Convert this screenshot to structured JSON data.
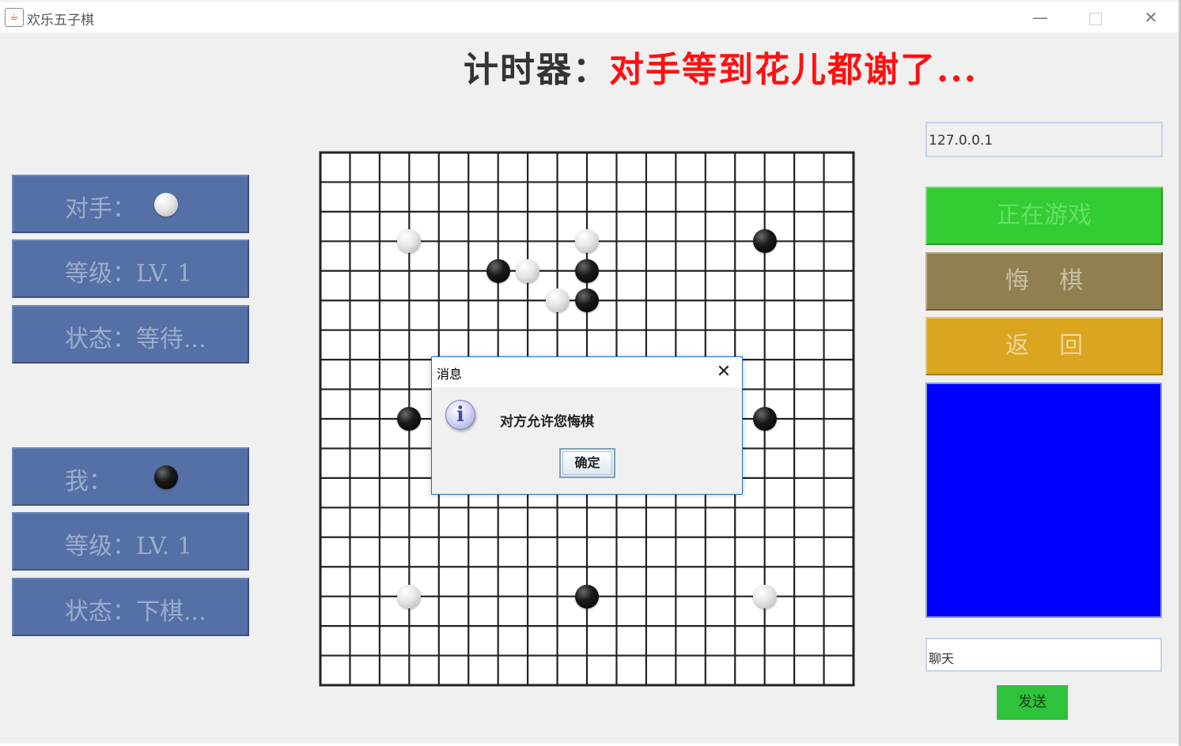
{
  "window": {
    "title": "欢乐五子棋",
    "minimize_glyph": "—",
    "close_glyph": "✕"
  },
  "timer": {
    "label": "计时器：",
    "value": "对手等到花儿都谢了..."
  },
  "opponent": {
    "label": "对手：",
    "stone": "white",
    "level": "等级：LV. 1",
    "status": "状态：等待..."
  },
  "me": {
    "label": "我：",
    "stone": "black",
    "level": "等级：LV. 1",
    "status": "状态：下棋..."
  },
  "board": {
    "size": 19,
    "stones": [
      {
        "color": "white",
        "col": 3,
        "row": 3
      },
      {
        "color": "white",
        "col": 9,
        "row": 3
      },
      {
        "color": "black",
        "col": 15,
        "row": 3
      },
      {
        "color": "black",
        "col": 6,
        "row": 4
      },
      {
        "color": "white",
        "col": 7,
        "row": 4
      },
      {
        "color": "black",
        "col": 9,
        "row": 4
      },
      {
        "color": "white",
        "col": 8,
        "row": 5
      },
      {
        "color": "black",
        "col": 9,
        "row": 5
      },
      {
        "color": "black",
        "col": 3,
        "row": 9
      },
      {
        "color": "black",
        "col": 15,
        "row": 9
      },
      {
        "color": "white",
        "col": 3,
        "row": 15
      },
      {
        "color": "black",
        "col": 9,
        "row": 15
      },
      {
        "color": "white",
        "col": 15,
        "row": 15
      }
    ]
  },
  "sidebar": {
    "ip_value": "127.0.0.1",
    "game_status_label": "正在游戏",
    "undo_label": "悔    棋",
    "back_label": "返    回",
    "chat_value": "聊天",
    "send_label": "发送"
  },
  "dialog": {
    "title": "消息",
    "message": "对方允许您悔棋",
    "ok_label": "确定",
    "icon_glyph": "i"
  },
  "colors": {
    "panel": "#5470a6",
    "game_status_bg": "#33cc33",
    "game_status_text": "#66e066",
    "undo_bg": "#8b7b47",
    "back_bg": "#daa520",
    "chat_area": "#0000ff",
    "send_bg": "#2ec33a",
    "timer_value": "#ff1010"
  }
}
